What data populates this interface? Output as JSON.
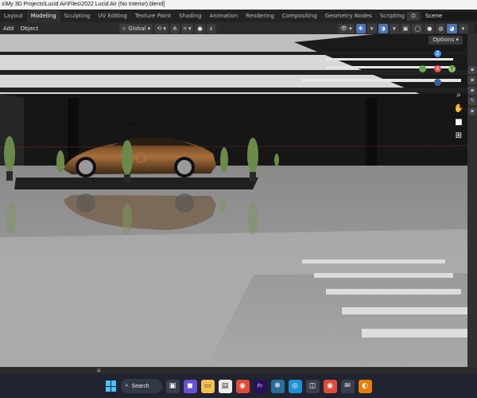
{
  "window": {
    "title": "s\\My 3D Projects\\Lucid Air\\Files\\2022 Lucid Air (No Interior).blend]"
  },
  "workspace_tabs": [
    {
      "label": "Layout",
      "active": false
    },
    {
      "label": "Modeling",
      "active": true
    },
    {
      "label": "Sculpting",
      "active": false
    },
    {
      "label": "UV Editing",
      "active": false
    },
    {
      "label": "Texture Paint",
      "active": false
    },
    {
      "label": "Shading",
      "active": false
    },
    {
      "label": "Animation",
      "active": false
    },
    {
      "label": "Rendering",
      "active": false
    },
    {
      "label": "Compositing",
      "active": false
    },
    {
      "label": "Geometry Nodes",
      "active": false
    },
    {
      "label": "Scripting",
      "active": false
    }
  ],
  "add_tab_label": "+",
  "scene": {
    "label": "Scene",
    "icon": "scene-icon"
  },
  "header_menu": {
    "add": "Add",
    "object": "Object"
  },
  "transform": {
    "orientation": "Global"
  },
  "viewport": {
    "options_label": "Options"
  },
  "gizmo_axes": {
    "z": "Z",
    "x": "X",
    "y": "Y"
  },
  "taskbar": {
    "search_label": "Search",
    "apps": [
      {
        "name": "explorer-icon",
        "glyph": "▭",
        "color": "#f2c14e"
      },
      {
        "name": "chrome-icon",
        "glyph": "◉",
        "color": "#e04b3a"
      },
      {
        "name": "premiere-icon",
        "glyph": "Pr",
        "color": "#2a0f5a"
      },
      {
        "name": "edge-icon",
        "glyph": "◎",
        "color": "#1f8fd6"
      },
      {
        "name": "blender-icon",
        "glyph": "◐",
        "color": "#e87d0d"
      }
    ]
  },
  "colors": {
    "accent": "#4a72b8",
    "axis_x": "#e64d4d",
    "axis_y": "#6aa84f",
    "axis_z": "#4a8cf0",
    "car_paint": "#8a5a2e"
  }
}
